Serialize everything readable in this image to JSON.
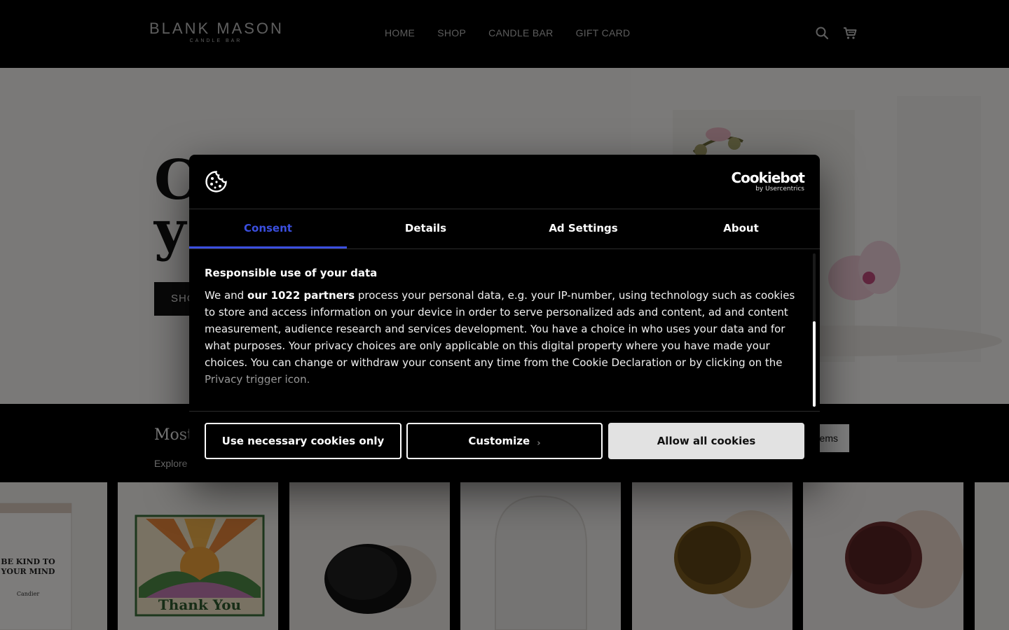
{
  "header": {
    "logo_main": "BLANK MASON",
    "logo_sub": "CANDLE BAR",
    "nav": [
      "HOME",
      "SHOP",
      "CANDLE BAR",
      "GIFT CARD"
    ],
    "icons": [
      "search-icon",
      "cart-icon"
    ]
  },
  "hero": {
    "title_line1": "C",
    "title_line2": "y",
    "button_label": "SHO"
  },
  "section": {
    "title": "Most",
    "subtitle": "Explore",
    "button_label": "ems"
  },
  "products": {
    "product1_label_line1": "BE KIND TO",
    "product1_label_line2": "YOUR MIND",
    "product1_brand": "Candier",
    "product2_label": "Thank You"
  },
  "dialog": {
    "brand_main": "Cookiebot",
    "brand_sub": "by Usercentrics",
    "tabs": [
      "Consent",
      "Details",
      "Ad Settings",
      "About"
    ],
    "body_title": "Responsible use of your data",
    "body_text_prefix": "We and ",
    "body_text_bold": "our 1022 partners",
    "body_text_rest": " process your personal data, e.g. your IP-number, using technology such as cookies to store and access information on your device in order to serve personalized ads and content, ad and content measurement, audience research and services development. You have a choice in who uses your data and for what purposes. Your privacy choices are only applicable on this digital property where you have made your choices. You can change or withdraw your consent any time from the Cookie Declaration or by clicking on the Privacy trigger icon.",
    "buttons": {
      "necessary": "Use necessary cookies only",
      "customize": "Customize",
      "allow": "Allow all cookies"
    }
  },
  "colors": {
    "accent": "#3b4fe0",
    "allow_button_bg": "#e2e2e2",
    "header_bg": "#000000"
  }
}
